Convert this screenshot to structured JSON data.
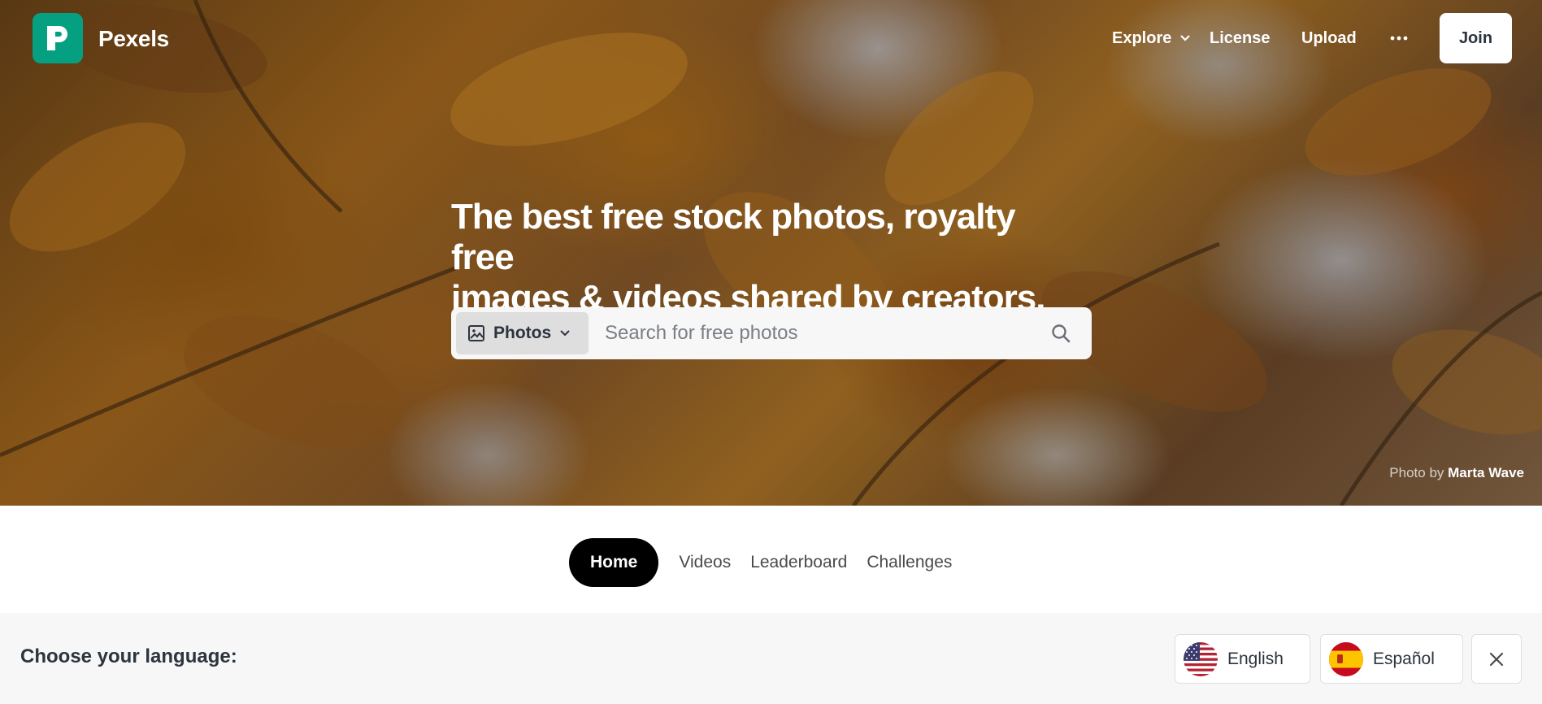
{
  "header": {
    "brand": "Pexels",
    "nav": {
      "explore": "Explore",
      "license": "License",
      "upload": "Upload",
      "more_icon": "ellipsis-icon"
    },
    "join_label": "Join"
  },
  "hero": {
    "headline_line1": "The best free stock photos, royalty free",
    "headline_line2": "images & videos shared by creators.",
    "search": {
      "type_label": "Photos",
      "placeholder": "Search for free photos"
    },
    "credit_prefix": "Photo by",
    "credit_author": "Marta Wave"
  },
  "tabs": [
    {
      "label": "Home",
      "active": true
    },
    {
      "label": "Videos",
      "active": false
    },
    {
      "label": "Leaderboard",
      "active": false
    },
    {
      "label": "Challenges",
      "active": false
    }
  ],
  "language_bar": {
    "title": "Choose your language:",
    "options": [
      {
        "label": "English",
        "flag": "us-flag-icon"
      },
      {
        "label": "Español",
        "flag": "es-flag-icon"
      }
    ]
  },
  "colors": {
    "brand": "#05a081",
    "active_tab": "#000000",
    "text": "#2c343e"
  }
}
